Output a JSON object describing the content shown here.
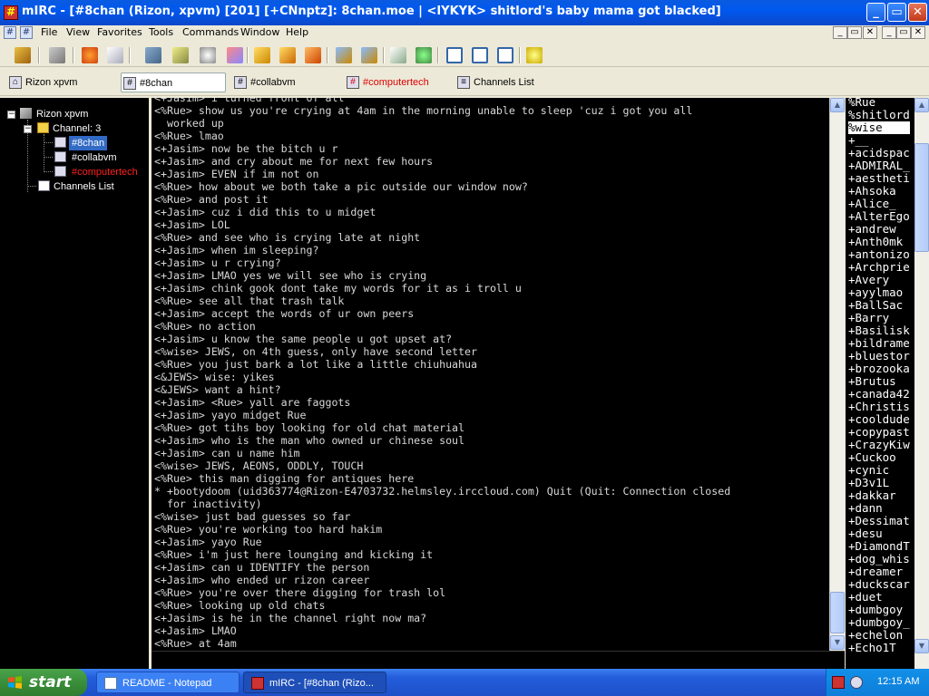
{
  "window": {
    "title": "mIRC - [#8chan (Rizon, xpvm) [201] [+CNnptz]: 8chan.moe | <IYKYK> shitlord's baby mama got blacked]"
  },
  "titlebar_buttons": {
    "minimize": "_",
    "maximize": "▭",
    "close": "✕"
  },
  "menu": {
    "items": [
      "File",
      "View",
      "Favorites",
      "Tools",
      "Commands",
      "Window",
      "Help"
    ],
    "mdi_controls": [
      "_",
      "▭",
      "✕"
    ]
  },
  "toolbar": {
    "icons": [
      "connect-icon",
      "options-icon",
      "favorites-icon",
      "address-book-icon",
      "channels-list-icon",
      "scripts-editor-icon",
      "timers-icon",
      "colors-icon",
      "dcc-send-icon",
      "dcc-chat-icon",
      "dcc-options-icon",
      "notify-list-icon",
      "urls-list-icon",
      "log-files-icon",
      "online-timer-icon",
      "tile-horizontal-icon",
      "tile-vertical-icon",
      "cascade-icon",
      "help-icon"
    ]
  },
  "switchbar": {
    "items": [
      {
        "label": "Rizon xpvm",
        "icon": "server-icon",
        "color": "#000000",
        "active": false
      },
      {
        "label": "#8chan",
        "icon": "channel-icon",
        "color": "#000000",
        "active": true
      },
      {
        "label": "#collabvm",
        "icon": "channel-icon",
        "color": "#000000",
        "active": false
      },
      {
        "label": "#computertech",
        "icon": "channel-icon",
        "color": "#dd0000",
        "active": false
      },
      {
        "label": "Channels List",
        "icon": "list-icon",
        "color": "#000000",
        "active": false
      }
    ]
  },
  "treebar": {
    "server": "Rizon xpvm",
    "folder": "Channel: 3",
    "channels": [
      {
        "label": "#8chan",
        "selected": true,
        "color": "#ffffff"
      },
      {
        "label": "#collabvm",
        "selected": false,
        "color": "#ffffff"
      },
      {
        "label": "#computertech",
        "selected": false,
        "color": "#ff2020"
      }
    ],
    "list_item": "Channels List"
  },
  "chat": {
    "lines": [
      "<+Jasim> i turned front of all",
      "<%Rue> show us you're crying at 4am in the morning unable to sleep 'cuz i got you all",
      "  worked up",
      "<%Rue> lmao",
      "<+Jasim> now be the bitch u r",
      "<+Jasim> and cry about me for next few hours",
      "<+Jasim> EVEN if im not on",
      "<%Rue> how about we both take a pic outside our window now?",
      "<%Rue> and post it",
      "<+Jasim> cuz i did this to u midget",
      "<+Jasim> LOL",
      "<%Rue> and see who is crying late at night",
      "<+Jasim> when im sleeping?",
      "<+Jasim> u r crying?",
      "<+Jasim> LMAO yes we will see who is crying",
      "<+Jasim> chink gook dont take my words for it as i troll u",
      "<%Rue> see all that trash talk",
      "<+Jasim> accept the words of ur own peers",
      "<%Rue> no action",
      "<+Jasim> u know the same people u got upset at?",
      "<%wise> JEWS, on 4th guess, only have second letter",
      "<%Rue> you just bark a lot like a little chiuhuahua",
      "<&JEWS> wise: yikes",
      "<&JEWS> want a hint?",
      "<+Jasim> <Rue> yall are faggots",
      "<+Jasim> yayo midget Rue",
      "<%Rue> got tihs boy looking for old chat material",
      "<+Jasim> who is the man who owned ur chinese soul",
      "<+Jasim> can u name him",
      "<%wise> JEWS, AEONS, ODDLY, TOUCH",
      "<%Rue> this man digging for antiques here",
      "* +bootydoom (uid363774@Rizon-E4703732.helmsley.irccloud.com) Quit (Quit: Connection closed",
      "  for inactivity)",
      "<%wise> just bad guesses so far",
      "<%Rue> you're working too hard hakim",
      "<+Jasim> yayo Rue",
      "<%Rue> i'm just here lounging and kicking it",
      "<+Jasim> can u IDENTIFY the person",
      "<+Jasim> who ended ur rizon career",
      "<%Rue> you're over there digging for trash lol",
      "<%Rue> looking up old chats",
      "<+Jasim> is he in the channel right now ma?",
      "<+Jasim> LMAO",
      "<%Rue> at 4am"
    ],
    "text_color": "#d8d8d8",
    "quit_color": "#ffffff"
  },
  "input": {
    "value": ""
  },
  "nicklist": {
    "selected_index": 2,
    "nicks": [
      "%Rue",
      "%shitlord",
      "%wise",
      "+__",
      "+acidspac",
      "+ADMIRAL_",
      "+aestheti",
      "+Ahsoka",
      "+Alice_",
      "+AlterEgo",
      "+andrew",
      "+Anth0mk",
      "+antonizo",
      "+Archprie",
      "+Avery",
      "+ayylmao",
      "+BallSac",
      "+Barry",
      "+Basilisk",
      "+bildrame",
      "+bluestor",
      "+brozooka",
      "+Brutus",
      "+canada42",
      "+Christis",
      "+cooldude",
      "+copypast",
      "+CrazyKiw",
      "+Cuckoo",
      "+cynic",
      "+D3v1L",
      "+dakkar",
      "+dann",
      "+Dessimat",
      "+desu",
      "+DiamondT",
      "+dog_whis",
      "+dreamer",
      "+duckscar",
      "+duet",
      "+dumbgoy",
      "+dumbgoy_",
      "+echelon",
      "+Echo1T"
    ]
  },
  "taskbar": {
    "start_label": "start",
    "tasks": [
      {
        "label": "README - Notepad",
        "icon": "notepad-icon",
        "active": false
      },
      {
        "label": "mIRC - [#8chan (Rizo...",
        "icon": "mirc-icon",
        "active": true
      }
    ],
    "clock": "12:15 AM"
  },
  "colors": {
    "title_blue": "#0058ee",
    "selection": "#316ac5",
    "chat_bg": "#000000",
    "taskbar_blue": "#245edb",
    "start_green": "#3a8e3a"
  }
}
